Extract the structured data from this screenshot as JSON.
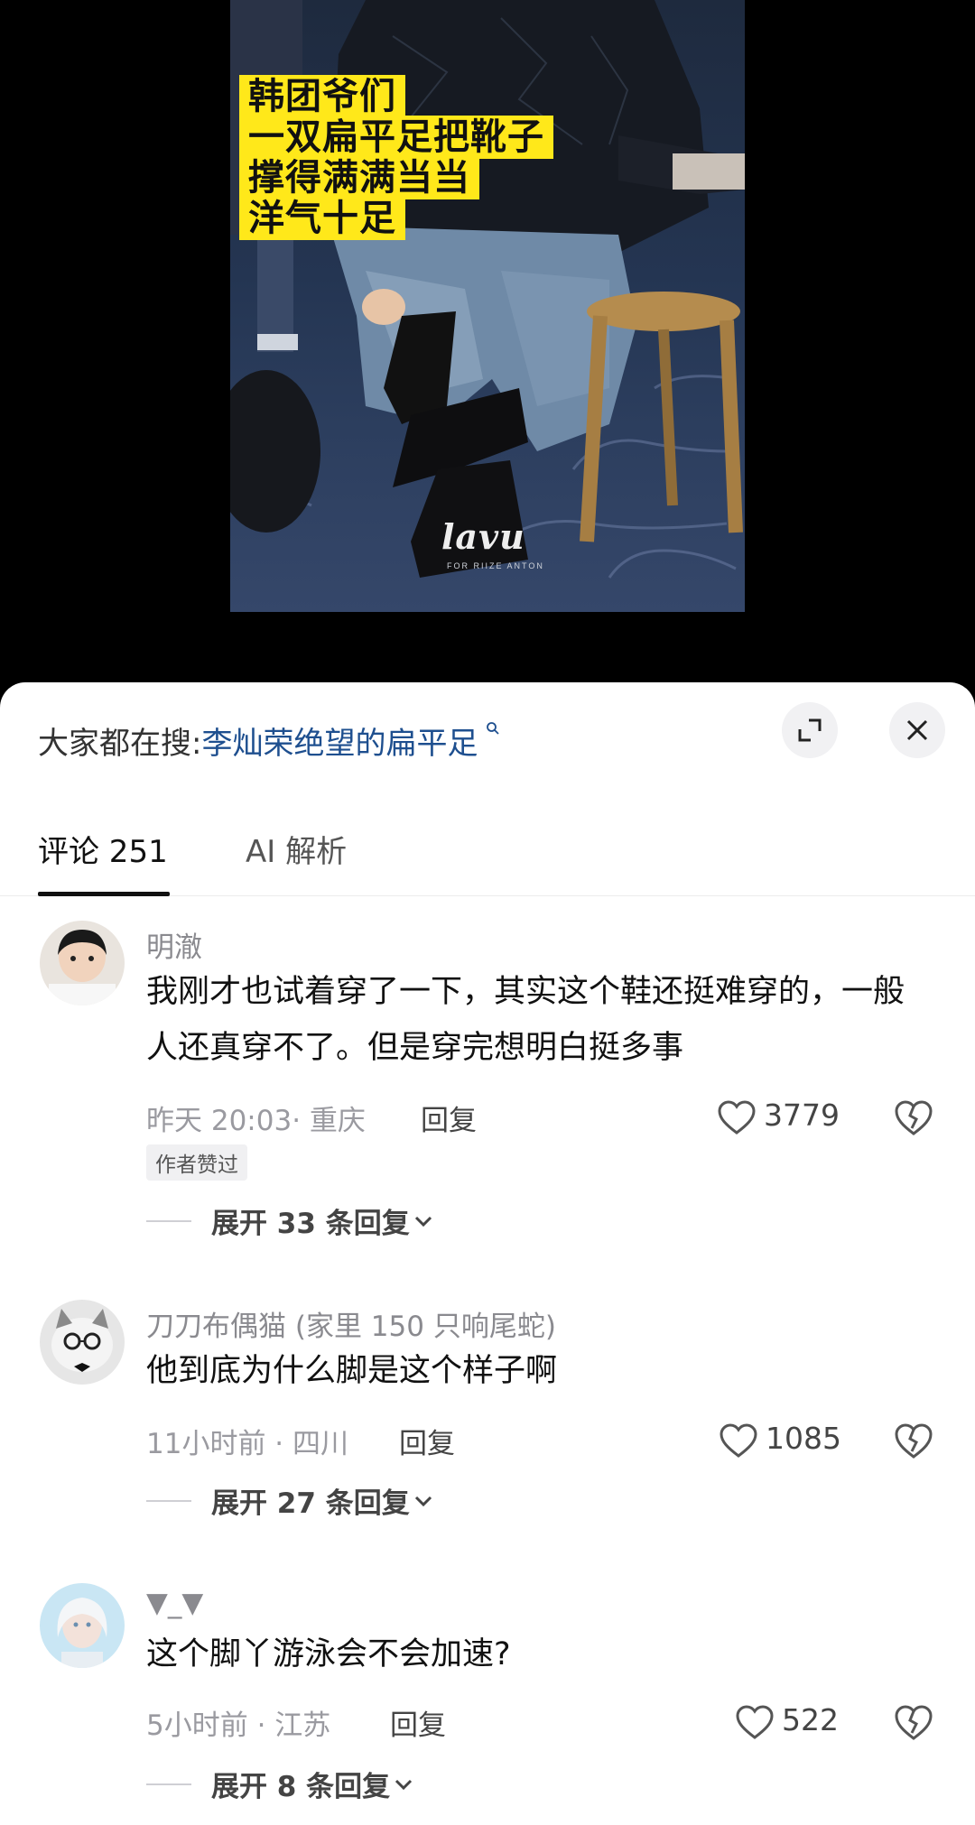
{
  "video": {
    "caption_lines": [
      "韩团爷们",
      "一双扁平足把靴子",
      "撑得满满当当",
      "洋气十足"
    ],
    "brand": "lavu",
    "brand_sub": "FOR RIIZE ANTON"
  },
  "search": {
    "prefix": "大家都在搜:",
    "term": "李灿荣绝望的扁平足"
  },
  "tabs": {
    "comments": "评论 251",
    "ai": "AI 解析"
  },
  "comments": [
    {
      "user": "明澈",
      "text": "我刚才也试着穿了一下，其实这个鞋还挺难穿的，一般人还真穿不了。但是穿完想明白挺多事",
      "meta": "昨天 20:03· 重庆",
      "reply": "回复",
      "likes": "3779",
      "badge": "作者赞过",
      "expand": "展开 33 条回复"
    },
    {
      "user": "刀刀布偶猫 (家里 150 只响尾蛇)",
      "text": "他到底为什么脚是这个样子啊",
      "meta": "11小时前 · 四川",
      "reply": "回复",
      "likes": "1085",
      "expand": "展开 27 条回复"
    },
    {
      "user": "▼_▼",
      "text": "这个脚丫游泳会不会加速?",
      "meta": "5小时前 · 江苏",
      "reply": "回复",
      "likes": "522",
      "expand": "展开 8 条回复"
    }
  ],
  "colors": {
    "caption_bg": "#ffe81a",
    "search_term": "#1e4f8f",
    "sheet_bg": "#ffffff"
  }
}
